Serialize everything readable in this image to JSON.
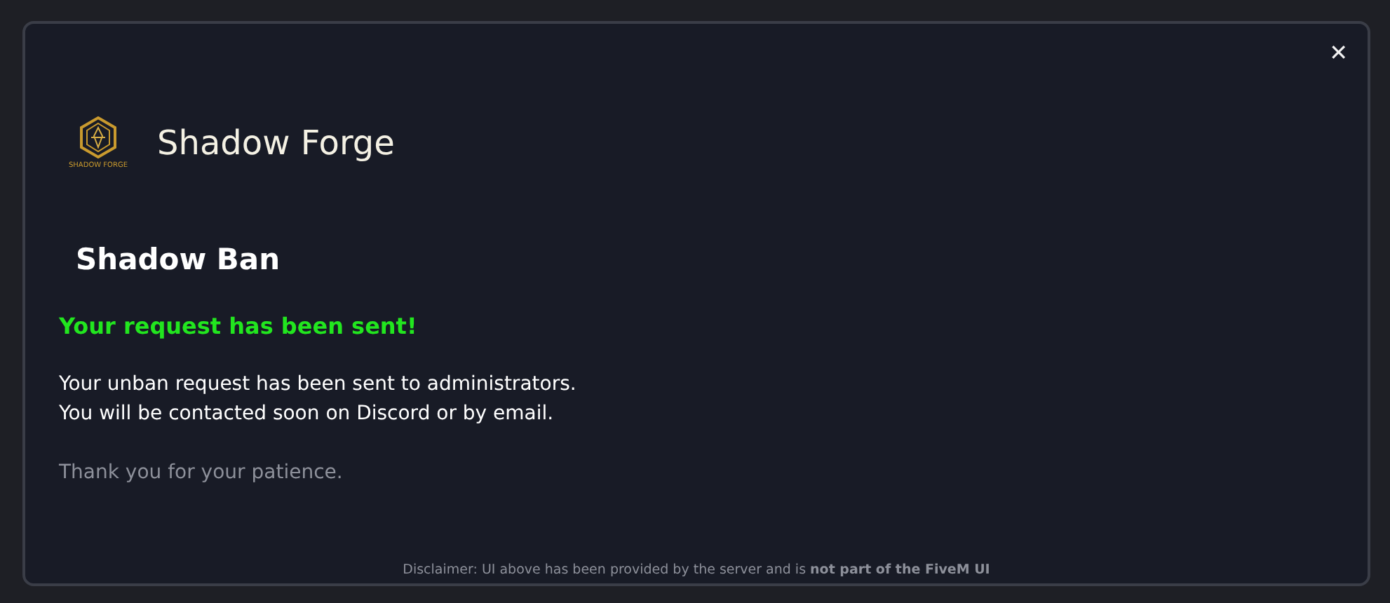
{
  "dialog": {
    "close_label": "✕",
    "logo_text": "SHADOW FORGE",
    "server_name": "Shadow Forge",
    "heading": "Shadow Ban",
    "success_message": "Your request has been sent!",
    "body_lines": [
      "Your unban request has been sent to administrators.",
      "You will be contacted soon on Discord or by email."
    ],
    "closing": "Thank you for your patience."
  },
  "disclaimer": "Disclaimer: UI above has been provided by the server and is **not part of the FiveM UI**"
}
